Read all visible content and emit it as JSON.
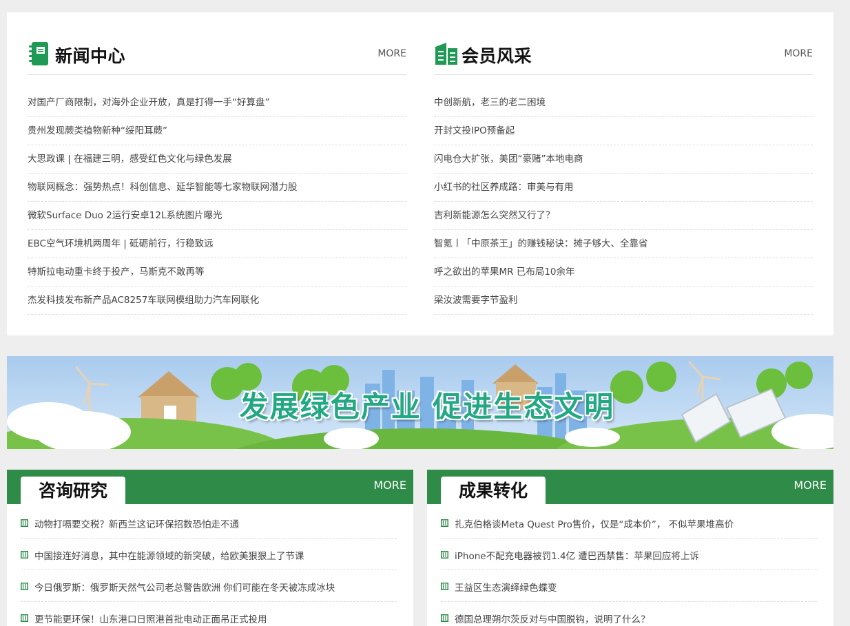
{
  "colors": {
    "accent_green": "#2e8b48",
    "icon_green": "#1f9a54",
    "page_bg": "#eeeeee"
  },
  "news_center": {
    "title": "新闻中心",
    "icon": "notebook-icon",
    "more": "MORE",
    "items": [
      "对国产厂商限制，对海外企业开放，真是打得一手“好算盘”",
      "贵州发现蕨类植物新种“绥阳耳蕨”",
      "大思政课 | 在福建三明，感受红色文化与绿色发展",
      "物联网概念：强势热点！科创信息、延华智能等七家物联网潜力股",
      "微软Surface Duo 2运行安卓12L系统图片曝光",
      "EBC空气环境机两周年 | 砥砺前行，行稳致远",
      "特斯拉电动重卡终于投产，马斯克不敢再等",
      "杰发科技发布新产品AC8257车联网模组助力汽车网联化"
    ]
  },
  "member_style": {
    "title": "会员风采",
    "icon": "buildings-icon",
    "more": "MORE",
    "items": [
      "中创新航，老三的老二困境",
      "开封文投IPO预备起",
      "闪电仓大扩张，美团“豪赌”本地电商",
      "小红书的社区养成路：审美与有用",
      "吉利新能源怎么突然又行了？",
      "智氪丨「中原茶王」的赚钱秘诀：摊子够大、全靠省",
      "呼之欲出的苹果MR 已布局10余年",
      "梁汝波需要字节盈利"
    ]
  },
  "banner": {
    "text": "发展绿色产业 促进生态文明"
  },
  "consulting": {
    "title": "咨询研究",
    "more": "MORE",
    "items": [
      "动物打嗝要交税？新西兰这记环保招数恐怕走不通",
      "中国接连好消息，其中在能源领域的新突破，给欧美狠狠上了节课",
      "今日俄罗斯：俄罗斯天然气公司老总警告欧洲 你们可能在冬天被冻成冰块",
      "更节能更环保！山东港口日照港首批电动正面吊正式投用"
    ]
  },
  "achievements": {
    "title": "成果转化",
    "more": "MORE",
    "items": [
      "扎克伯格谈Meta Quest Pro售价，仅是“成本价”， 不似苹果堆高价",
      "iPhone不配充电器被罚1.4亿 遭巴西禁售：苹果回应将上诉",
      "王益区生态演绎绿色蝶变",
      "德国总理朔尔茨反对与中国脱钩，说明了什么？"
    ]
  }
}
